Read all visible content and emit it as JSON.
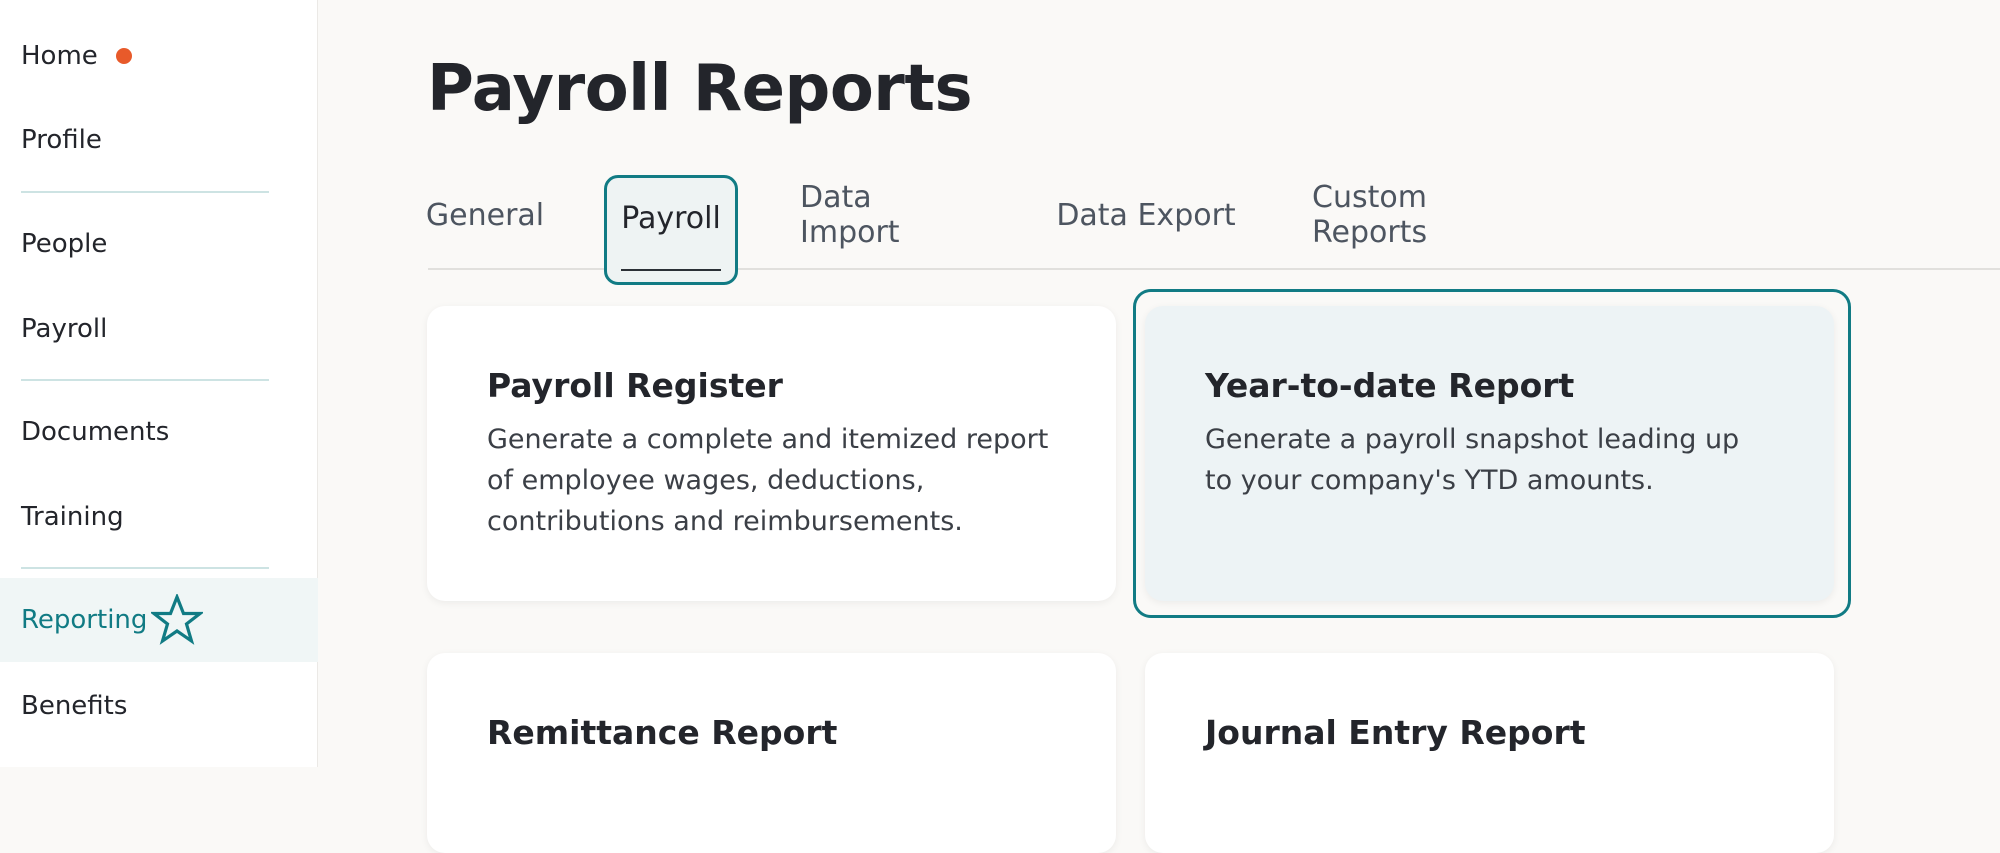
{
  "sidebar": {
    "items": [
      {
        "label": "Home"
      },
      {
        "label": "Profile"
      },
      {
        "label": "People"
      },
      {
        "label": "Payroll"
      },
      {
        "label": "Documents"
      },
      {
        "label": "Training"
      },
      {
        "label": "Reporting"
      },
      {
        "label": "Benefits"
      }
    ],
    "active_item": "Reporting",
    "notification_color": "#e85a2a"
  },
  "page": {
    "title": "Payroll Reports"
  },
  "tabs": [
    {
      "label": "General"
    },
    {
      "label": "Payroll"
    },
    {
      "label": "Data Import"
    },
    {
      "label": "Data Export"
    },
    {
      "label": "Custom Reports"
    }
  ],
  "active_tab": "Payroll",
  "cards": [
    {
      "title": "Payroll Register",
      "description": "Generate a complete and itemized report of employee wages, deductions, contributions and reimbursements."
    },
    {
      "title": "Year-to-date Report",
      "description": "Generate a payroll snapshot leading up to your company's YTD amounts."
    },
    {
      "title": "Remittance Report",
      "description": ""
    },
    {
      "title": "Journal Entry Report",
      "description": ""
    }
  ],
  "selected_card": "Year-to-date Report",
  "colors": {
    "accent": "#117b84",
    "selected_card_bg": "#edf3f5",
    "page_bg": "#faf9f7"
  }
}
